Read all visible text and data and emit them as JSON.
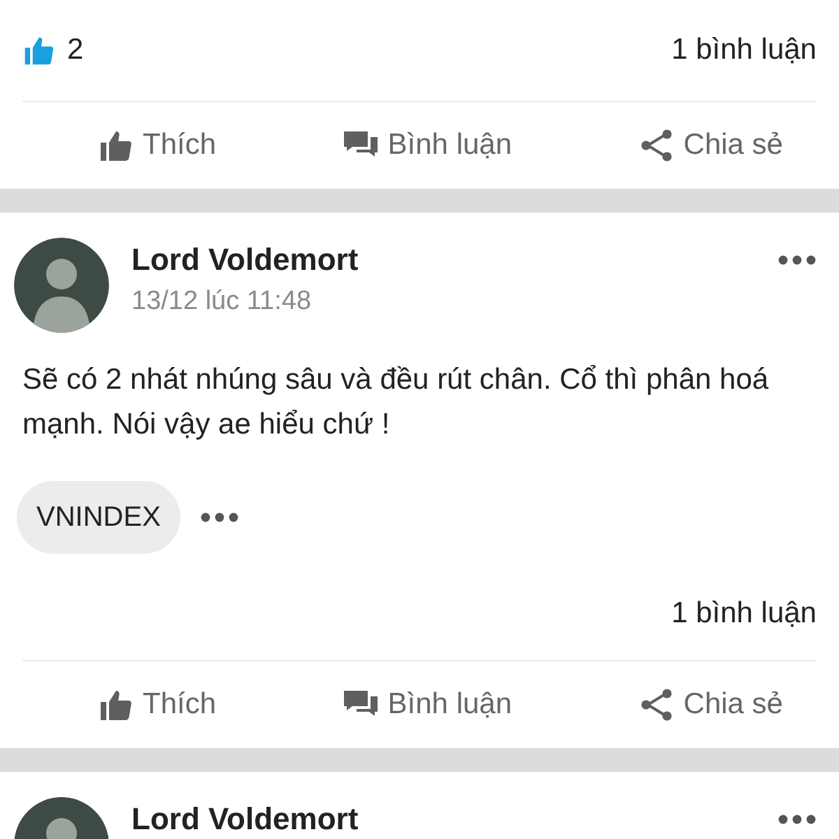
{
  "posts": [
    {
      "likes": "2",
      "comment_count": "1 bình luận",
      "actions": [
        {
          "kind": "like",
          "label": "Thích"
        },
        {
          "kind": "comment",
          "label": "Bình luận"
        },
        {
          "kind": "share",
          "label": "Chia sẻ"
        }
      ]
    },
    {
      "author": "Lord Voldemort",
      "time": "13/12 lúc 11:48",
      "text": "Sẽ có 2 nhát nhúng sâu và đều rút chân. Cổ thì phân hoá mạnh. Nói vậy ae hiểu chứ !",
      "tags": [
        "VNINDEX"
      ],
      "comment_count": "1 bình luận",
      "actions": [
        {
          "kind": "like",
          "label": "Thích"
        },
        {
          "kind": "comment",
          "label": "Bình luận"
        },
        {
          "kind": "share",
          "label": "Chia sẻ"
        }
      ]
    },
    {
      "author": "Lord Voldemort"
    }
  ]
}
